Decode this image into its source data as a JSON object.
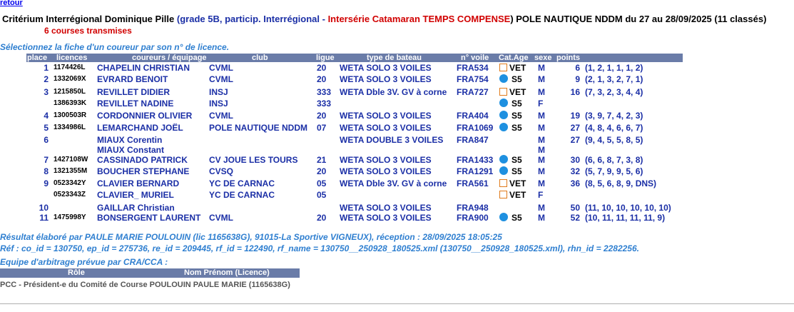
{
  "nav": {
    "retour": "retour"
  },
  "header": {
    "event": "Critérium Interrégional Dominique Pille",
    "grade": "(grade 5B, particip. Interrégional",
    "sep": " - ",
    "serie": "Intersérie Catamaran TEMPS COMPENSE",
    "club_dates": ") POLE NAUTIQUE NDDM du 27 au 28/09/2025 (11 classés)",
    "courses": "6 courses transmises"
  },
  "instruction": "Sélectionnez la fiche d'un coureur par son n° de licence.",
  "columns": {
    "place": "place",
    "licences": "licences",
    "coureurs": "coureurs / équipage",
    "club": "club",
    "ligue": "ligue",
    "bateau": "type de bateau",
    "voile": "n° voile",
    "catage": "Cat.Age",
    "sexe": "sexe",
    "points": "points"
  },
  "rows": [
    {
      "place": "1",
      "lic": "1174426L",
      "name": "CHAPELIN CHRISTIAN",
      "club": "CVML",
      "ligue": "20",
      "boat": "WETA SOLO 3 VOILES",
      "voile": "FRA534",
      "cat": "VET",
      "sexe": "M",
      "points": "6",
      "detail": "(1, 2, 1, 1, 1, 2)"
    },
    {
      "place": "2",
      "lic": "1332069X",
      "name": "EVRARD BENOIT",
      "club": "CVML",
      "ligue": "20",
      "boat": "WETA SOLO 3 VOILES",
      "voile": "FRA754",
      "cat": "S5",
      "sexe": "M",
      "points": "9",
      "detail": "(2, 1, 3, 2, 7, 1)"
    },
    {
      "place": "3",
      "lic": "1215850L",
      "name": "REVILLET DIDIER",
      "club": "INSJ",
      "ligue": "333",
      "boat": "WETA Dble 3V. GV à corne",
      "voile": "FRA727",
      "cat": "VET",
      "sexe": "M",
      "points": "16",
      "detail": "(7, 3, 2, 3, 4, 4)"
    },
    {
      "place": "",
      "lic": "1386393K",
      "name": "REVILLET NADINE",
      "club": "INSJ",
      "ligue": "333",
      "boat": "",
      "voile": "",
      "cat": "S5",
      "sexe": "F",
      "points": "",
      "detail": ""
    },
    {
      "place": "4",
      "lic": "1300503R",
      "name": "CORDONNIER OLIVIER",
      "club": "CVML",
      "ligue": "20",
      "boat": "WETA SOLO 3 VOILES",
      "voile": "FRA404",
      "cat": "S5",
      "sexe": "M",
      "points": "19",
      "detail": "(3, 9, 7, 4, 2, 3)"
    },
    {
      "place": "5",
      "lic": "1334986L",
      "name": "LEMARCHAND JOËL",
      "club": "POLE NAUTIQUE NDDM",
      "ligue": "07",
      "boat": "WETA SOLO 3 VOILES",
      "voile": "FRA1069",
      "cat": "S5",
      "sexe": "M",
      "points": "27",
      "detail": "(4, 8, 4, 6, 6, 7)"
    },
    {
      "place": "6",
      "lic": "",
      "name": "MIAUX Corentin",
      "club": "",
      "ligue": "",
      "boat": "WETA DOUBLE 3 VOILES",
      "voile": "FRA847",
      "cat": "",
      "sexe": "M",
      "points": "27",
      "detail": "(9, 4, 5, 5, 8, 5)"
    },
    {
      "place": "",
      "lic": "",
      "name": "MIAUX Constant",
      "club": "",
      "ligue": "",
      "boat": "",
      "voile": "",
      "cat": "",
      "sexe": "M",
      "points": "",
      "detail": ""
    },
    {
      "place": "7",
      "lic": "1427108W",
      "name": "CASSINADO PATRICK",
      "club": "CV JOUE LES TOURS",
      "ligue": "21",
      "boat": "WETA SOLO 3 VOILES",
      "voile": "FRA1433",
      "cat": "S5",
      "sexe": "M",
      "points": "30",
      "detail": "(6, 6, 8, 7, 3, 8)"
    },
    {
      "place": "8",
      "lic": "1321355M",
      "name": "BOUCHER STEPHANE",
      "club": "CVSQ",
      "ligue": "20",
      "boat": "WETA SOLO 3 VOILES",
      "voile": "FRA1291",
      "cat": "S5",
      "sexe": "M",
      "points": "32",
      "detail": "(5, 7, 9, 9, 5, 6)"
    },
    {
      "place": "9",
      "lic": "0523342Y",
      "name": "CLAVIER BERNARD",
      "club": "YC DE CARNAC",
      "ligue": "05",
      "boat": "WETA Dble 3V. GV à corne",
      "voile": "FRA561",
      "cat": "VET",
      "sexe": "M",
      "points": "36",
      "detail": "(8, 5, 6, 8, 9, DNS)"
    },
    {
      "place": "",
      "lic": "0523343Z",
      "name": "CLAVIER_ MURIEL",
      "club": "YC DE CARNAC",
      "ligue": "05",
      "boat": "",
      "voile": "",
      "cat": "VET",
      "sexe": "F",
      "points": "",
      "detail": ""
    },
    {
      "place": "10",
      "lic": "",
      "name": "GAILLAR Christian",
      "club": "",
      "ligue": "",
      "boat": "WETA SOLO 3 VOILES",
      "voile": "FRA948",
      "cat": "",
      "sexe": "M",
      "points": "50",
      "detail": "(11, 10, 10, 10, 10, 10)"
    },
    {
      "place": "11",
      "lic": "1475998Y",
      "name": "BONSERGENT LAURENT",
      "club": "CVML",
      "ligue": "20",
      "boat": "WETA SOLO 3 VOILES",
      "voile": "FRA900",
      "cat": "S5",
      "sexe": "M",
      "points": "52",
      "detail": "(10, 11, 11, 11, 11, 9)"
    }
  ],
  "footer": {
    "result": "Résultat élaboré par PAULE MARIE POULOUIN (lic 1165638G), 91015-La Sportive VIGNEUX), réception : 28/09/2025 18:05:25",
    "ref": "Réf : co_id = 130750, ep_id = 275736, re_id = 209445, rf_id = 122490, rf_name = 130750__250928_180525.xml (130750__250928_180525.xml), rhn_id = 2282256.",
    "arbitrage": "Equipe d'arbitrage prévue par CRA/CCA :",
    "arb_col_role": "Rôle",
    "arb_col_name": "Nom Prénom (Licence)",
    "arb_role": "PCC - Président-e du Comité de Course",
    "arb_name": "POULOUIN PAULE MARIE (1165638G)"
  },
  "colors": {
    "header_bg": "#6a7ca8",
    "blue_text": "#1b2fa6",
    "red_text": "#d10000",
    "italic_blue": "#2f7fd0",
    "s5_dot": "#1e90e0",
    "vet_box": "#e07a1a"
  },
  "icons": {
    "vet": "vet-box-icon",
    "s5": "s5-dot-icon"
  }
}
